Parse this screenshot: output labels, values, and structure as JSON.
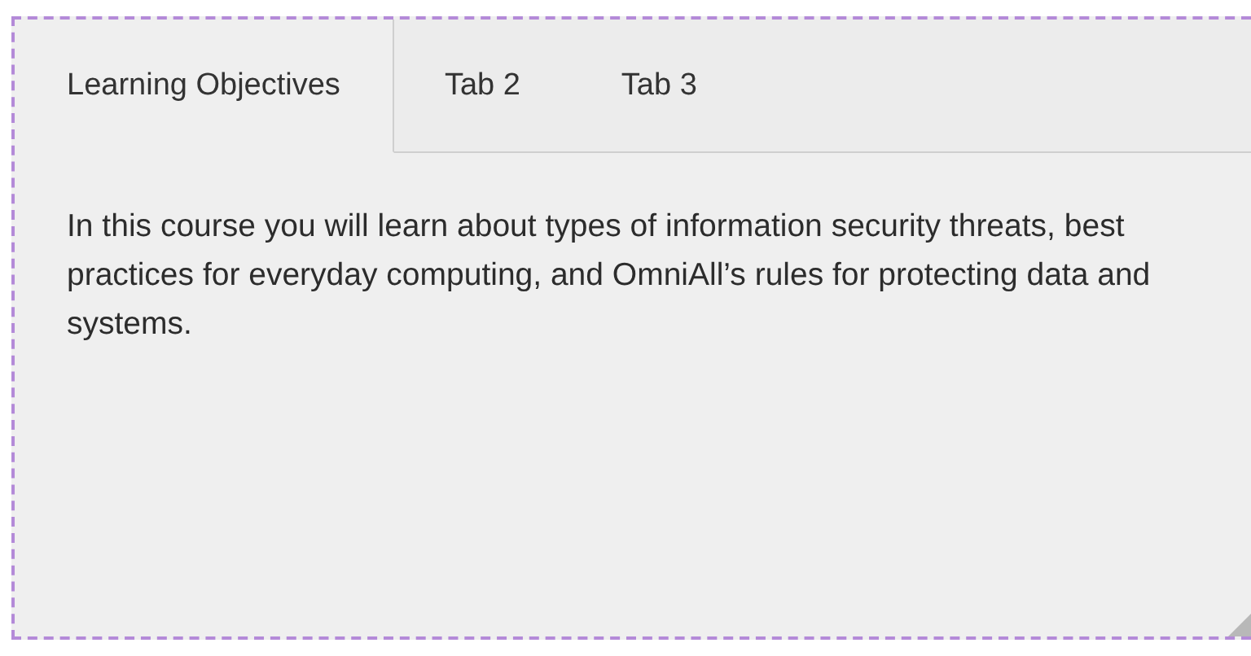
{
  "tabs": [
    {
      "label": "Learning Objectives",
      "selected": true
    },
    {
      "label": "Tab 2",
      "selected": false
    },
    {
      "label": "Tab 3",
      "selected": false
    }
  ],
  "content": {
    "text": "In this course you will learn about types of information security threats, best practices for everyday computing, and OmniAll’s rules for protecting data and systems."
  }
}
